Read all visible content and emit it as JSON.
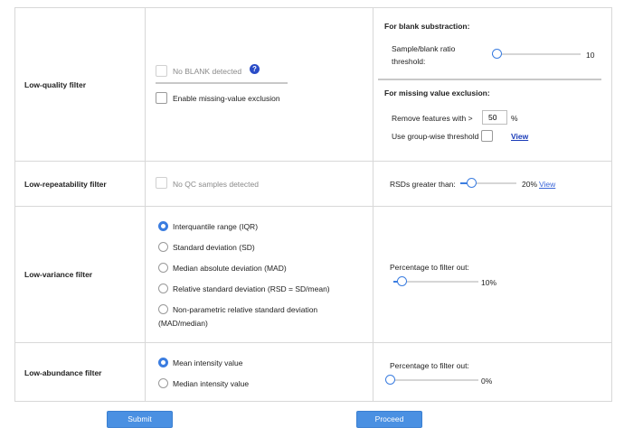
{
  "rows": {
    "low_quality": {
      "label": "Low-quality filter"
    },
    "low_repeatability": {
      "label": "Low-repeatability filter"
    },
    "low_variance": {
      "label": "Low-variance filter"
    },
    "low_abundance": {
      "label": "Low-abundance filter"
    }
  },
  "quality": {
    "no_blank_label": "No BLANK detected",
    "help_glyph": "?",
    "missing_label": "Enable missing-value exclusion",
    "blank_section_title": "For blank substraction:",
    "ratio_label_line1": "Sample/blank ratio",
    "ratio_label_line2": "threshold:",
    "ratio_value": "10",
    "ratio_level": 0.05,
    "missing_section_title": "For missing value exclusion:",
    "remove_label": "Remove features with >",
    "remove_value": "50",
    "percent_sign": "%",
    "groupwise_label": "Use group-wise threshold",
    "view_link": "View"
  },
  "repeatability": {
    "no_qc_label": "No QC samples detected",
    "rsd_label": "RSDs greater than:",
    "rsd_value": "20%",
    "rsd_level": 0.2,
    "view_link": "View"
  },
  "variance": {
    "options": [
      "Interquantile range (IQR)",
      "Standard deviation (SD)",
      "Median absolute deviation (MAD)",
      "Relative standard deviation (RSD = SD/mean)",
      "Non-parametric relative standard deviation",
      "(MAD/median)"
    ],
    "selected_index": 0,
    "percent_label": "Percentage to filter out:",
    "percent_value": "10%",
    "percent_level": 0.1
  },
  "abundance": {
    "options": [
      "Mean intensity value",
      "Median intensity value"
    ],
    "selected_index": 0,
    "percent_label": "Percentage to filter out:",
    "percent_value": "0%",
    "percent_level": 0.0
  },
  "buttons": {
    "submit": "Submit",
    "proceed": "Proceed"
  },
  "colors": {
    "accent": "#3b7de0",
    "button": "#4a90e2",
    "link": "#1a3bb8"
  }
}
